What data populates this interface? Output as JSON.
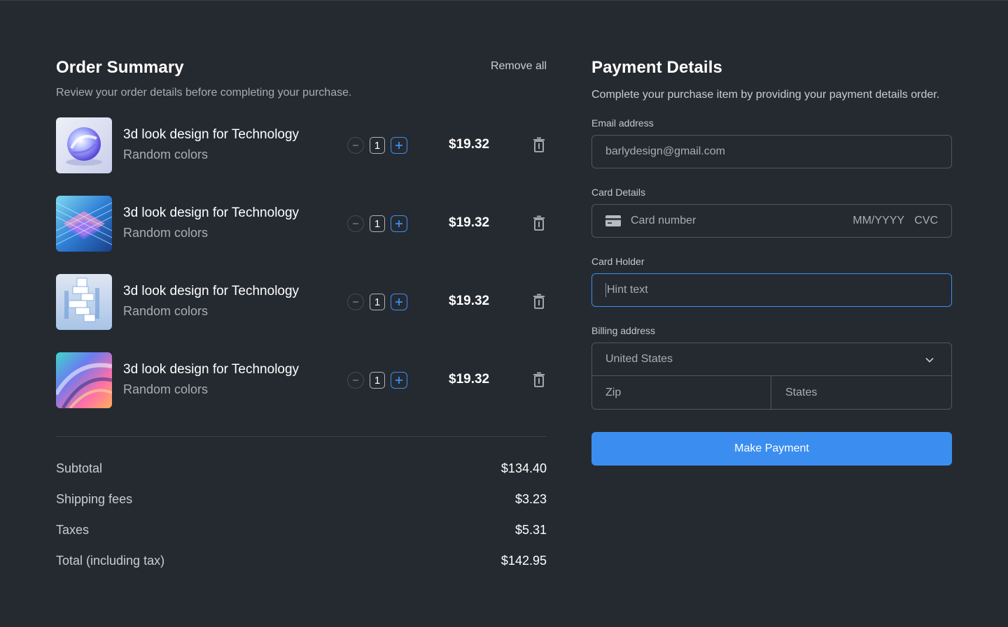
{
  "order": {
    "title": "Order Summary",
    "subtitle": "Review your order details before completing your purchase.",
    "remove_all": "Remove all",
    "items": [
      {
        "name": "3d look design for Technology",
        "variant": "Random colors",
        "qty": "1",
        "price": "$19.32"
      },
      {
        "name": "3d look design for Technology",
        "variant": "Random colors",
        "qty": "1",
        "price": "$19.32"
      },
      {
        "name": "3d look design for Technology",
        "variant": "Random colors",
        "qty": "1",
        "price": "$19.32"
      },
      {
        "name": "3d look design for Technology",
        "variant": "Random colors",
        "qty": "1",
        "price": "$19.32"
      }
    ],
    "totals": [
      {
        "label": "Subtotal",
        "value": "$134.40"
      },
      {
        "label": "Shipping fees",
        "value": "$3.23"
      },
      {
        "label": "Taxes",
        "value": "$5.31"
      },
      {
        "label": "Total (including tax)",
        "value": "$142.95"
      }
    ]
  },
  "payment": {
    "title": "Payment Details",
    "subtitle": "Complete your purchase item by providing your payment details order.",
    "email_label": "Email address",
    "email_value": "barlydesign@gmail.com",
    "card_label": "Card Details",
    "card_number_placeholder": "Card number",
    "card_expiry_placeholder": "MM/YYYY",
    "card_cvc_placeholder": "CVC",
    "holder_label": "Card Holder",
    "holder_placeholder": "Hint text",
    "billing_label": "Billing address",
    "country": "United States",
    "zip_placeholder": "Zip",
    "state_placeholder": "States",
    "submit_label": "Make Payment"
  },
  "icons": {
    "quantity_decrease": "minus-icon",
    "quantity_increase": "plus-icon",
    "remove_item": "trash-icon",
    "card": "credit-card-icon",
    "dropdown": "chevron-down-icon"
  },
  "colors": {
    "background": "#252a31",
    "accent": "#3b8ef0",
    "border": "#50575f",
    "muted_text": "#a8adb4"
  }
}
